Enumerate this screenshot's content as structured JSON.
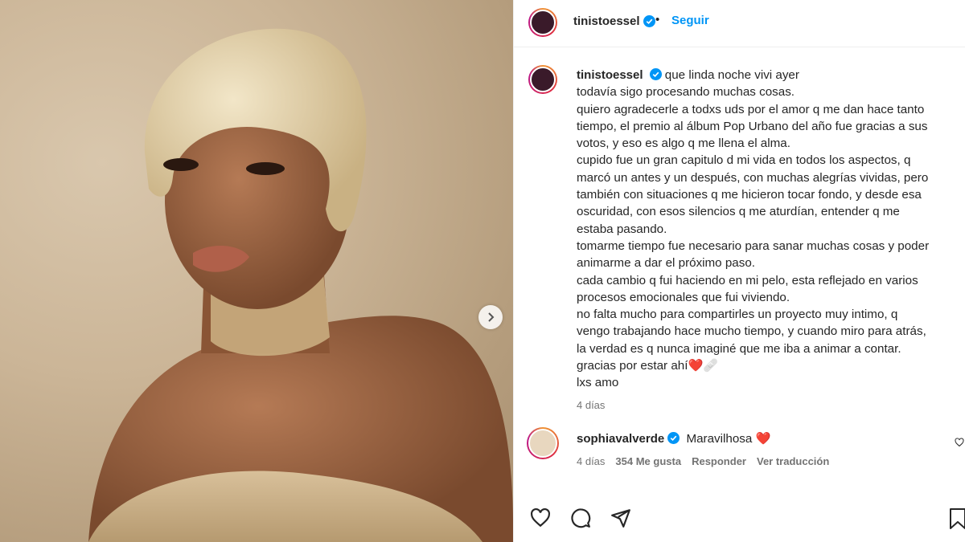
{
  "post": {
    "username": "tinistoessel",
    "follow_label": "Seguir",
    "caption_first": "que linda noche vivi ayer",
    "caption_lines": [
      "todavía sigo procesando muchas cosas.",
      "quiero agradecerle a todxs uds por el amor q me dan hace tanto",
      "tiempo, el premio al álbum Pop Urbano del año fue gracias a sus",
      "votos, y eso es algo q me llena el alma.",
      "cupido fue un gran capitulo d mi vida en todos los aspectos, q",
      "marcó un antes y un después, con muchas alegrías vividas, pero",
      "también con situaciones q me hicieron tocar fondo, y desde esa",
      "oscuridad, con esos silencios q me aturdían, entender q me",
      "estaba pasando.",
      "tomarme tiempo fue necesario para sanar muchas cosas y poder",
      "animarme a dar el próximo paso.",
      "cada cambio q fui haciendo en mi pelo, esta reflejado en varios",
      "procesos emocionales que fui viviendo.",
      "no falta mucho para compartirles un proyecto muy intimo, q",
      "vengo trabajando hace mucho tiempo, y cuando miro para atrás,",
      "la verdad es q nunca imaginé que me iba a animar a contar.",
      "gracias por estar ahí❤️🩹",
      "lxs amo"
    ],
    "time_ago": "4 días"
  },
  "comment": {
    "username": "sophiavalverde",
    "text": "Maravilhosa ❤️",
    "time_ago": "4 días",
    "likes": "354 Me gusta",
    "reply_label": "Responder",
    "translate_label": "Ver traducción"
  },
  "colors": {
    "accent": "#0095f6",
    "verified": "#0095f6",
    "heart": "#ed4956"
  }
}
